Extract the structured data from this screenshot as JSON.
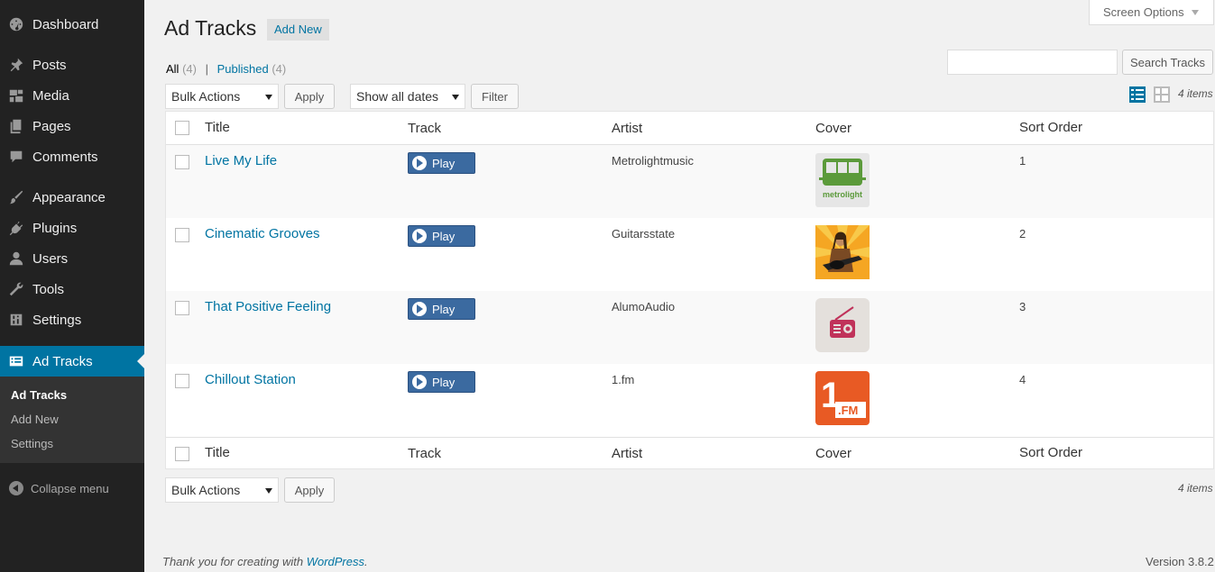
{
  "sidebar": {
    "items": [
      {
        "label": "Dashboard",
        "icon": "dashboard-icon"
      },
      {
        "label": "Posts",
        "icon": "pin-icon"
      },
      {
        "label": "Media",
        "icon": "media-icon"
      },
      {
        "label": "Pages",
        "icon": "pages-icon"
      },
      {
        "label": "Comments",
        "icon": "comment-icon"
      },
      {
        "label": "Appearance",
        "icon": "brush-icon"
      },
      {
        "label": "Plugins",
        "icon": "plugin-icon"
      },
      {
        "label": "Users",
        "icon": "user-icon"
      },
      {
        "label": "Tools",
        "icon": "wrench-icon"
      },
      {
        "label": "Settings",
        "icon": "settings-icon"
      },
      {
        "label": "Ad Tracks",
        "icon": "list-icon"
      }
    ],
    "submenu": [
      "Ad Tracks",
      "Add New",
      "Settings"
    ],
    "collapse_label": "Collapse menu"
  },
  "header": {
    "title": "Ad Tracks",
    "add_new": "Add New",
    "screen_options": "Screen Options"
  },
  "filters": {
    "all_label": "All",
    "all_count": "(4)",
    "separator": "|",
    "published_label": "Published",
    "published_count": "(4)"
  },
  "search": {
    "value": "",
    "button": "Search Tracks"
  },
  "toolbar": {
    "bulk_actions": "Bulk Actions",
    "apply": "Apply",
    "dates": "Show all dates",
    "filter": "Filter",
    "items_count": "4 items"
  },
  "table": {
    "columns": [
      "Title",
      "Track",
      "Artist",
      "Cover",
      "Sort Order"
    ],
    "play_label": "Play",
    "rows": [
      {
        "title": "Live My Life",
        "artist": "Metrolightmusic",
        "sort": "1",
        "cover": "metrolight",
        "cover_text": "metrolight"
      },
      {
        "title": "Cinematic Grooves",
        "artist": "Guitarsstate",
        "sort": "2",
        "cover": "guitarist"
      },
      {
        "title": "That Positive Feeling",
        "artist": "AlumoAudio",
        "sort": "3",
        "cover": "radio"
      },
      {
        "title": "Chillout Station",
        "artist": "1.fm",
        "sort": "4",
        "cover": "1fm",
        "cover_text_1": "1",
        "cover_text_2": ".FM"
      }
    ]
  },
  "footer": {
    "thanks": "Thank you for creating with ",
    "wp_link": "WordPress",
    "period": ".",
    "version": "Version 3.8.2"
  },
  "colors": {
    "sidebar_bg": "#222222",
    "active_bg": "#0074a2",
    "link": "#0074a2",
    "play_button": "#3b6aa0"
  }
}
